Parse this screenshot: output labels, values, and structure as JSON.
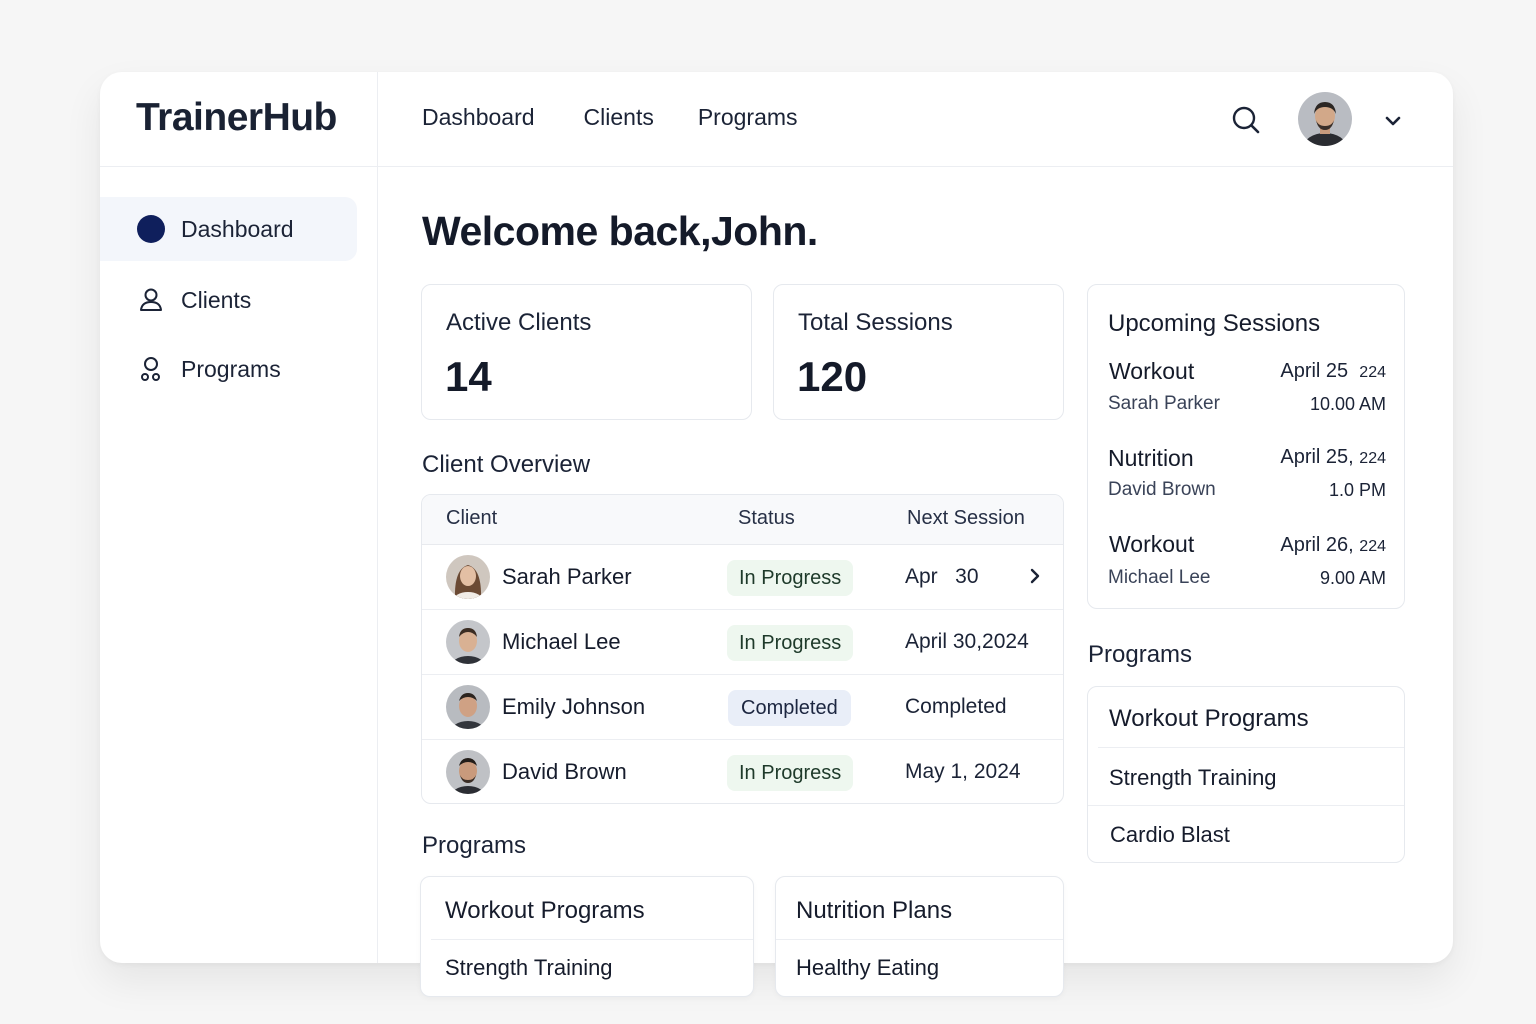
{
  "app": {
    "name": "TrainerHub"
  },
  "top_nav": {
    "items": [
      "Dashboard",
      "Clients",
      "Programs"
    ]
  },
  "sidebar": {
    "items": [
      {
        "label": "Dashboard",
        "icon": "dashboard-dot-icon",
        "active": true
      },
      {
        "label": "Clients",
        "icon": "user-icon",
        "active": false
      },
      {
        "label": "Programs",
        "icon": "programs-icon",
        "active": false
      }
    ]
  },
  "welcome": "Welcome back,John.",
  "stats": [
    {
      "label": "Active Clients",
      "value": "14"
    },
    {
      "label": "Total Sessions",
      "value": "120"
    }
  ],
  "client_overview": {
    "title": "Client Overview",
    "columns": [
      "Client",
      "Status",
      "Next Session"
    ],
    "rows": [
      {
        "name": "Sarah Parker",
        "status": "In Progress",
        "status_type": "progress",
        "next": "Apr   30"
      },
      {
        "name": "Michael Lee",
        "status": "In Progress",
        "status_type": "progress",
        "next": "April 30,2024"
      },
      {
        "name": "Emily Johnson",
        "status": "Completed",
        "status_type": "completed",
        "next": "Completed"
      },
      {
        "name": "David Brown",
        "status": "In Progress",
        "status_type": "progress",
        "next": "May 1, 2024"
      }
    ]
  },
  "programs_section": {
    "title": "Programs",
    "cards": [
      {
        "title": "Workout Programs",
        "item": "Strength Training"
      },
      {
        "title": "Nutrition Plans",
        "item": "Healthy Eating"
      }
    ]
  },
  "upcoming": {
    "title": "Upcoming Sessions",
    "sessions": [
      {
        "type": "Workout",
        "client": "Sarah Parker",
        "date": "April 25",
        "year": "224",
        "time": "10.00 AM"
      },
      {
        "type": "Nutrition",
        "client": "David Brown",
        "date": "April 25,",
        "year": "224",
        "time": "1.0 PM"
      },
      {
        "type": "Workout",
        "client": "Michael Lee",
        "date": "April 26,",
        "year": "224",
        "time": "9.00 AM"
      }
    ]
  },
  "right_programs": {
    "title": "Programs",
    "card_title": "Workout Programs",
    "items": [
      "Strength Training",
      "Cardio Blast"
    ]
  },
  "colors": {
    "accent": "#0f1f5c",
    "progress_badge": "#eef7ef",
    "completed_badge": "#e9eef8"
  }
}
